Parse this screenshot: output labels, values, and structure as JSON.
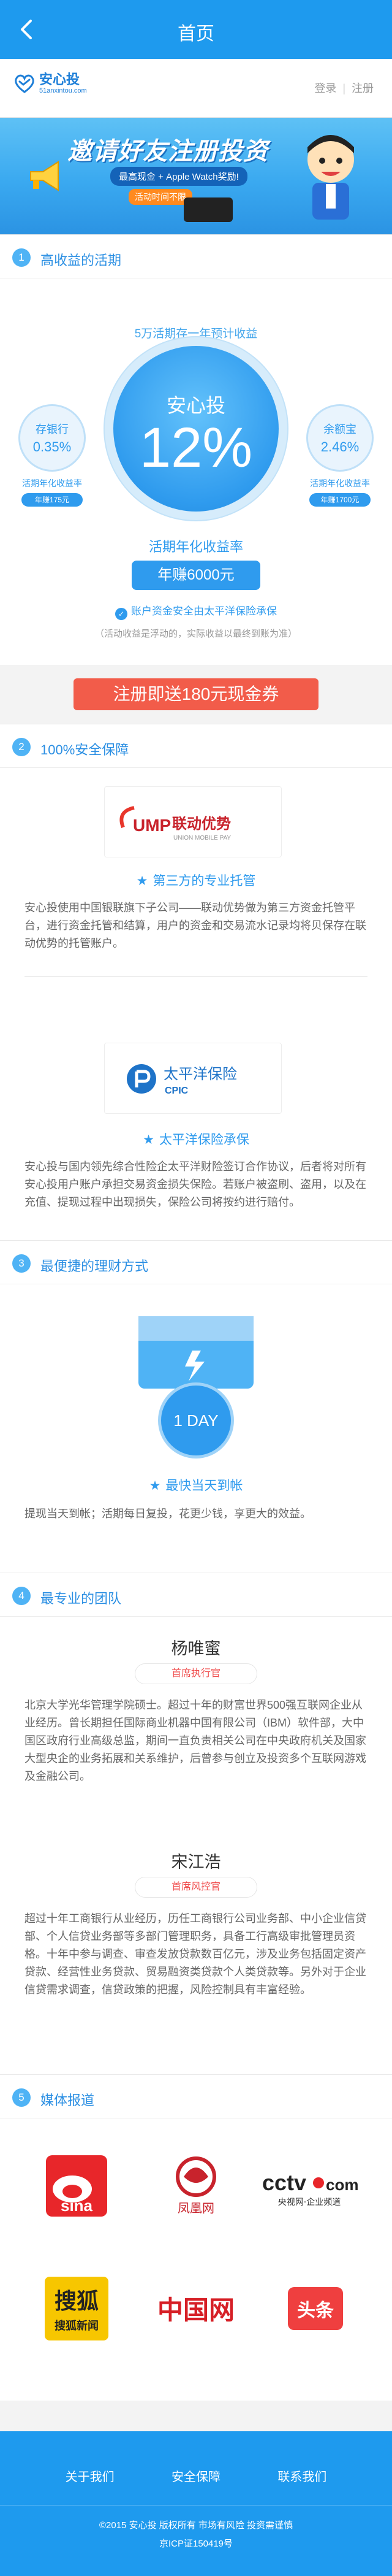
{
  "topbar": {
    "title": "首页",
    "back_icon": "chevron-left-icon"
  },
  "logo": {
    "name": "安心投",
    "domain": "51anxintou.com"
  },
  "auth": {
    "login": "登录",
    "register": "注册",
    "separator": "|"
  },
  "banner": {
    "headline": "邀请好友注册投资",
    "pill": "最高现金 + Apple Watch奖励!",
    "sub": "活动时间不限"
  },
  "section1": {
    "number": "1",
    "title": "高收益的活期",
    "caption_top": "5万活期存一年预计收益",
    "main": {
      "name": "安心投",
      "rate": "12%",
      "caption": "活期年化收益率",
      "earn": "年赚6000元"
    },
    "left": {
      "name": "存银行",
      "rate": "0.35%",
      "caption": "活期年化收益率",
      "earn": "年赚175元"
    },
    "right": {
      "name": "余额宝",
      "rate": "2.46%",
      "caption": "活期年化收益率",
      "earn": "年赚1700元"
    },
    "insure": "账户资金安全由太平洋保险承保",
    "note": "（活动收益是浮动的，实际收益以最终到账为准）"
  },
  "cta": {
    "label": "注册即送180元现金券"
  },
  "section2": {
    "number": "2",
    "title": "100%安全保障",
    "ump_logo": {
      "cn": "联动优势",
      "en": "UNION MOBILE PAY",
      "mark": "UMP"
    },
    "feature1": "第三方的专业托管",
    "para1": "安心投使用中国银联旗下子公司——联动优势做为第三方资金托管平台，进行资金托管和结算，用户的资金和交易流水记录均将贝保存在联动优势的托管账户。",
    "cpic_logo": {
      "cn": "太平洋保险",
      "en": "CPIC"
    },
    "feature2": "太平洋保险承保",
    "para2": "安心投与国内领先综合性险企太平洋财险签订合作协议，后者将对所有安心投用户账户承担交易资金损失保险。若账户被盗刷、盗用，以及在充值、提现过程中出现损失，保险公司将按约进行赔付。"
  },
  "section3": {
    "number": "3",
    "title": "最便捷的理财方式",
    "day_badge": "1 DAY",
    "feature": "最快当天到帐",
    "para": "提现当天到帐；活期每日复投，花更少钱，享更大的效益。"
  },
  "section4": {
    "number": "4",
    "title": "最专业的团队",
    "members": [
      {
        "name": "杨唯蜜",
        "role": "首席执行官",
        "bio": "北京大学光华管理学院硕士。超过十年的财富世界500强互联网企业从业经历。曾长期担任国际商业机器中国有限公司（IBM）软件部，大中国区政府行业高级总监，期间一直负责相关公司在中央政府机关及国家大型央企的业务拓展和关系维护，后曾参与创立及投资多个互联网游戏及金融公司。"
      },
      {
        "name": "宋江浩",
        "role": "首席风控官",
        "bio": "超过十年工商银行从业经历，历任工商银行公司业务部、中小企业信贷部、个人信贷业务部等多部门管理职务，具备工行高级审批管理员资格。十年中参与调查、审查发放贷款数百亿元，涉及业务包括固定资产贷款、经营性业务贷款、贸易融资类贷款个人类贷款等。另外对于企业信贷需求调查，信贷政策的把握，风险控制具有丰富经验。"
      }
    ]
  },
  "section5": {
    "number": "5",
    "title": "媒体报道",
    "media": [
      {
        "name": "sina",
        "label": "sina"
      },
      {
        "name": "ifeng",
        "label": "凤凰网"
      },
      {
        "name": "cctv",
        "label": "央视网·企业频道"
      },
      {
        "name": "sohu",
        "label": "搜狐新闻"
      },
      {
        "name": "chinanet",
        "label": "中国网"
      },
      {
        "name": "toutiao",
        "label": "头条"
      }
    ]
  },
  "footer": {
    "links": [
      "关于我们",
      "安全保障",
      "联系我们"
    ],
    "copyright": "©2015 安心投 版权所有 市场有风险 投资需谨慎",
    "icp": "京ICP证150419号"
  },
  "colors": {
    "primary": "#1e9aee",
    "cta": "#f25c4a",
    "accent_text": "#2b8fe3"
  }
}
